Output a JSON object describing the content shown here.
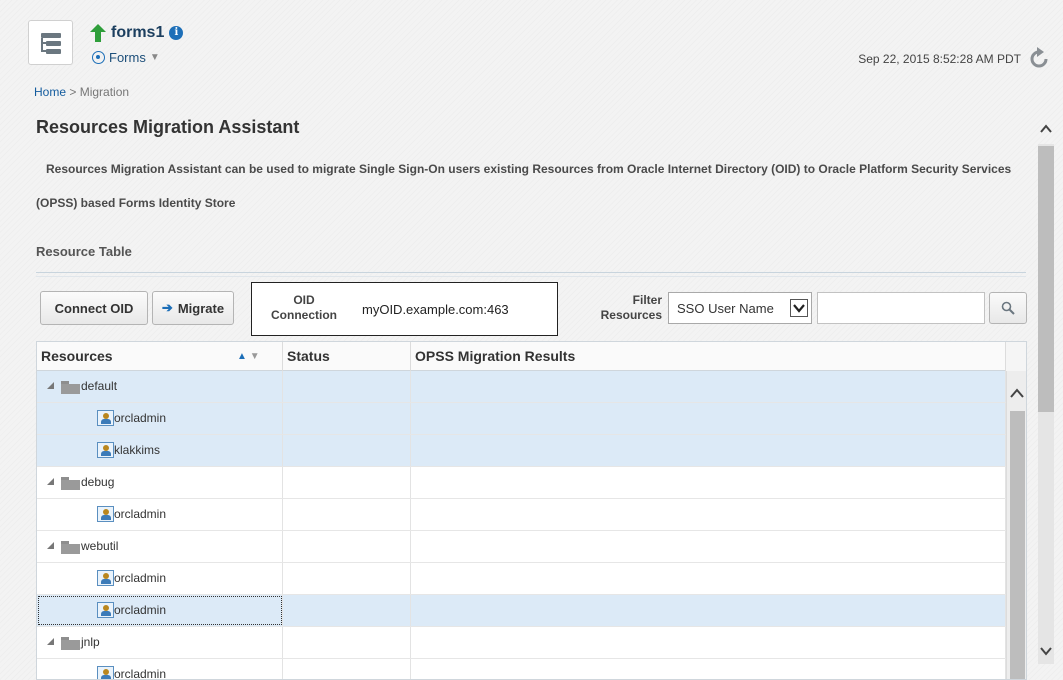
{
  "header": {
    "target_name": "forms1",
    "target_menu": "Forms",
    "timestamp": "Sep 22, 2015 8:52:28 AM PDT"
  },
  "breadcrumb": {
    "home": "Home",
    "separator": " > ",
    "current": "Migration"
  },
  "page": {
    "title": "Resources Migration Assistant",
    "description": "Resources Migration Assistant can be used to migrate Single Sign-On users existing Resources from Oracle Internet Directory (OID) to Oracle Platform Security Services (OPSS) based Forms Identity Store",
    "section_title": "Resource Table"
  },
  "toolbar": {
    "connect_label": "Connect OID",
    "migrate_label": "Migrate",
    "oid_label_1": "OID",
    "oid_label_2": "Connection",
    "oid_value": "myOID.example.com:463",
    "filter_label_1": "Filter",
    "filter_label_2": "Resources",
    "filter_selected": "SSO User Name",
    "search_value": ""
  },
  "table": {
    "columns": [
      "Resources",
      "Status",
      "OPSS Migration Results"
    ],
    "rows": [
      {
        "type": "group",
        "label": "default",
        "selected": true
      },
      {
        "type": "user",
        "label": "orcladmin",
        "selected": true
      },
      {
        "type": "user",
        "label": "klakkims",
        "selected": true
      },
      {
        "type": "group",
        "label": "debug",
        "selected": false
      },
      {
        "type": "user",
        "label": "orcladmin",
        "selected": false
      },
      {
        "type": "group",
        "label": "webutil",
        "selected": false
      },
      {
        "type": "user",
        "label": "orcladmin",
        "selected": false
      },
      {
        "type": "user",
        "label": "orcladmin",
        "selected": true,
        "focused": true
      },
      {
        "type": "group",
        "label": "jnlp",
        "selected": false
      },
      {
        "type": "user",
        "label": "orcladmin",
        "selected": false
      }
    ]
  },
  "colors": {
    "accent": "#1d6fb8",
    "selected_row": "#dceaf7",
    "up_arrow": "#2e9e3a"
  },
  "icons": {
    "nav": "navigation-menu-icon",
    "status": "up-arrow-icon",
    "info": "info-icon",
    "refresh": "refresh-icon",
    "folder": "folder-icon",
    "user": "user-icon",
    "search": "search-icon"
  }
}
